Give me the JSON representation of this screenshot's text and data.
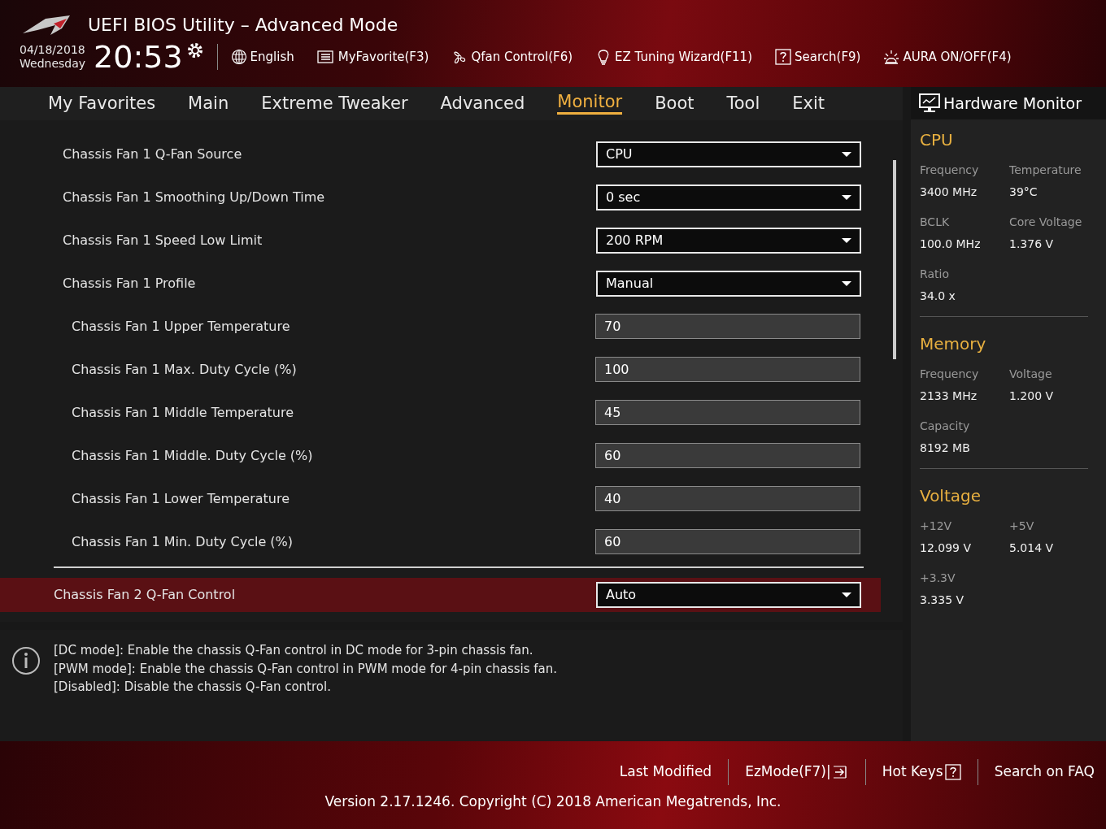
{
  "header": {
    "title": "UEFI BIOS Utility – Advanced Mode",
    "date": "04/18/2018",
    "day": "Wednesday",
    "time": "20:53",
    "tools": [
      {
        "kind": "globe",
        "label": "English"
      },
      {
        "kind": "list",
        "label": "MyFavorite(F3)"
      },
      {
        "kind": "fan",
        "label": "Qfan Control(F6)"
      },
      {
        "kind": "bulb",
        "label": "EZ Tuning Wizard(F11)"
      },
      {
        "kind": "help",
        "label": "Search(F9)"
      },
      {
        "kind": "light",
        "label": "AURA ON/OFF(F4)"
      }
    ]
  },
  "tabs": [
    {
      "label": "My Favorites",
      "selected": false
    },
    {
      "label": "Main",
      "selected": false
    },
    {
      "label": "Extreme Tweaker",
      "selected": false
    },
    {
      "label": "Advanced",
      "selected": false
    },
    {
      "label": "Monitor",
      "selected": true
    },
    {
      "label": "Boot",
      "selected": false
    },
    {
      "label": "Tool",
      "selected": false
    },
    {
      "label": "Exit",
      "selected": false
    }
  ],
  "settings": [
    {
      "label": "Chassis Fan 1 Q-Fan Source",
      "kind": "dropdown",
      "value": "CPU",
      "selected": false
    },
    {
      "label": "Chassis Fan 1 Smoothing Up/Down Time",
      "kind": "dropdown",
      "value": "0 sec",
      "selected": false
    },
    {
      "label": "Chassis Fan 1 Speed Low Limit",
      "kind": "dropdown",
      "value": "200 RPM",
      "selected": false
    },
    {
      "label": "Chassis Fan 1 Profile",
      "kind": "dropdown",
      "value": "Manual",
      "selected": false,
      "children": [
        {
          "label": "Chassis Fan 1 Upper Temperature",
          "kind": "input",
          "value": "70",
          "selected": false
        },
        {
          "label": "Chassis Fan 1 Max. Duty Cycle (%)",
          "kind": "input",
          "value": "100",
          "selected": false
        },
        {
          "label": "Chassis Fan 1 Middle Temperature",
          "kind": "input",
          "value": "45",
          "selected": false
        },
        {
          "label": "Chassis Fan 1 Middle. Duty Cycle (%)",
          "kind": "input",
          "value": "60",
          "selected": false
        },
        {
          "label": "Chassis Fan 1 Lower Temperature",
          "kind": "input",
          "value": "40",
          "selected": false
        },
        {
          "label": "Chassis Fan 1 Min. Duty Cycle (%)",
          "kind": "input",
          "value": "60",
          "selected": false
        }
      ]
    }
  ],
  "focused_setting": {
    "label": "Chassis Fan 2 Q-Fan Control",
    "kind": "dropdown",
    "value": "Auto",
    "selected": true
  },
  "help": [
    "[DC mode]: Enable the chassis Q-Fan control in DC mode for 3-pin chassis fan.",
    "[PWM mode]: Enable the chassis Q-Fan control in PWM mode for 4-pin chassis fan.",
    "[Disabled]: Disable the chassis Q-Fan control."
  ],
  "hardware_monitor": {
    "title": "Hardware Monitor",
    "sections": [
      {
        "title": "CPU",
        "items": [
          {
            "label": "Frequency",
            "value": "3400 MHz"
          },
          {
            "label": "Temperature",
            "value": "39°C"
          },
          {
            "label": "BCLK",
            "value": "100.0 MHz"
          },
          {
            "label": "Core Voltage",
            "value": "1.376 V"
          },
          {
            "label": "Ratio",
            "value": "34.0 x"
          }
        ]
      },
      {
        "title": "Memory",
        "items": [
          {
            "label": "Frequency",
            "value": "2133 MHz"
          },
          {
            "label": "Voltage",
            "value": "1.200 V"
          },
          {
            "label": "Capacity",
            "value": "8192 MB"
          }
        ]
      },
      {
        "title": "Voltage",
        "items": [
          {
            "label": "+12V",
            "value": "12.099 V"
          },
          {
            "label": "+5V",
            "value": "5.014 V"
          },
          {
            "label": "+3.3V",
            "value": "3.335 V"
          }
        ]
      }
    ]
  },
  "footer": {
    "links": [
      {
        "label": "Last Modified",
        "kind": "text"
      },
      {
        "label": "EzMode(F7)|",
        "kind": "exit"
      },
      {
        "label": "Hot Keys",
        "kind": "help"
      },
      {
        "label": "Search on FAQ",
        "kind": "text"
      }
    ],
    "version": "Version 2.17.1246. Copyright (C) 2018 American Megatrends, Inc."
  }
}
